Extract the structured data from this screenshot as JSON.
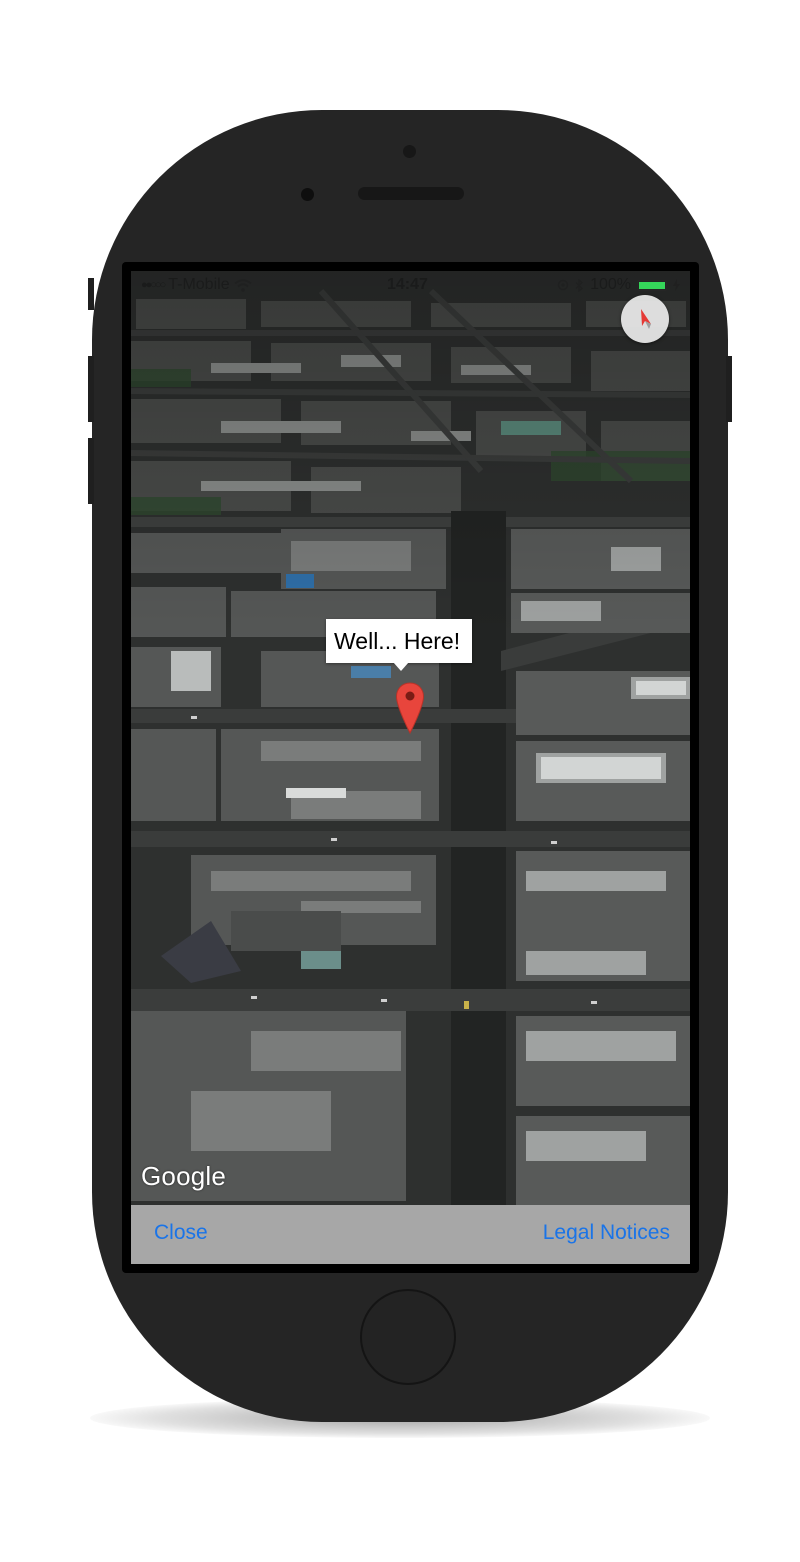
{
  "status_bar": {
    "signal": "●●○○○",
    "carrier": "T-Mobile",
    "time": "14:47",
    "battery_percent": "100%",
    "battery_level": 1.0,
    "battery_color": "#35d65a",
    "icons": [
      "wifi-icon",
      "location-icon",
      "bluetooth-icon",
      "charging-icon"
    ]
  },
  "map": {
    "view": "satellite",
    "compass_icon": "compass-needle-icon",
    "marker_icon": "map-pin-icon",
    "marker_color": "#e8453c",
    "callout_text": "Well... Here!",
    "attribution": "Google"
  },
  "bottom_bar": {
    "close_label": "Close",
    "legal_label": "Legal Notices",
    "link_color": "#1a74e8",
    "background": "#a7a7a7"
  },
  "device": {
    "body_color": "#252525"
  }
}
